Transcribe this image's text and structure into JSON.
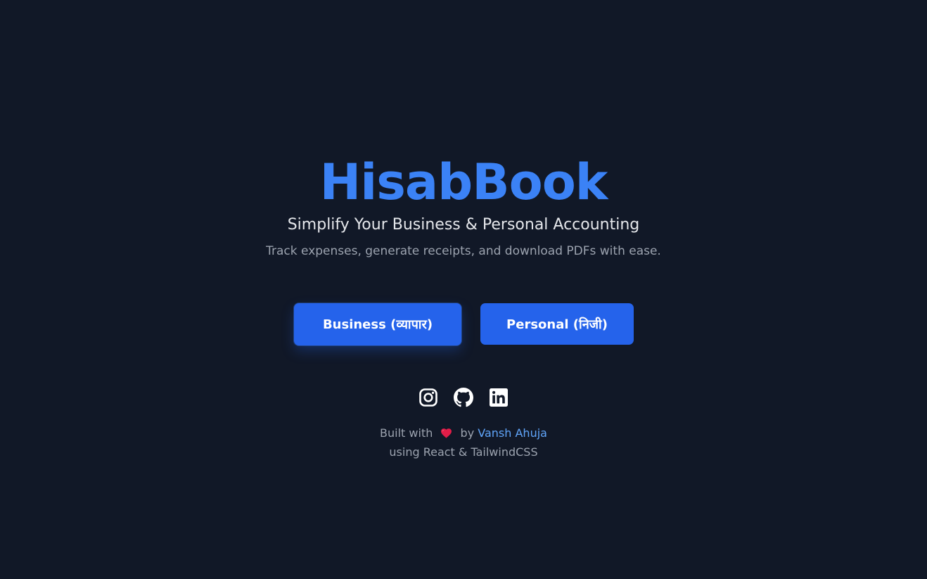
{
  "app": {
    "title": "HisabBook",
    "subtitle": "Simplify Your Business & Personal Accounting",
    "tagline": "Track expenses, generate receipts, and download PDFs with ease."
  },
  "buttons": {
    "business_label": "Business (व्यापार)",
    "personal_label": "Personal (निजी)"
  },
  "socials": [
    {
      "icon": "instagram-icon"
    },
    {
      "icon": "github-icon"
    },
    {
      "icon": "linkedin-icon"
    }
  ],
  "footer": {
    "built_with": "Built with",
    "heart_icon": "heart-icon",
    "by": "by",
    "author": "Vansh Ahuja",
    "tech": "using React & TailwindCSS"
  },
  "colors": {
    "background": "#111827",
    "accent": "#3b82f6",
    "button": "#2563eb",
    "link": "#60a5fa"
  }
}
